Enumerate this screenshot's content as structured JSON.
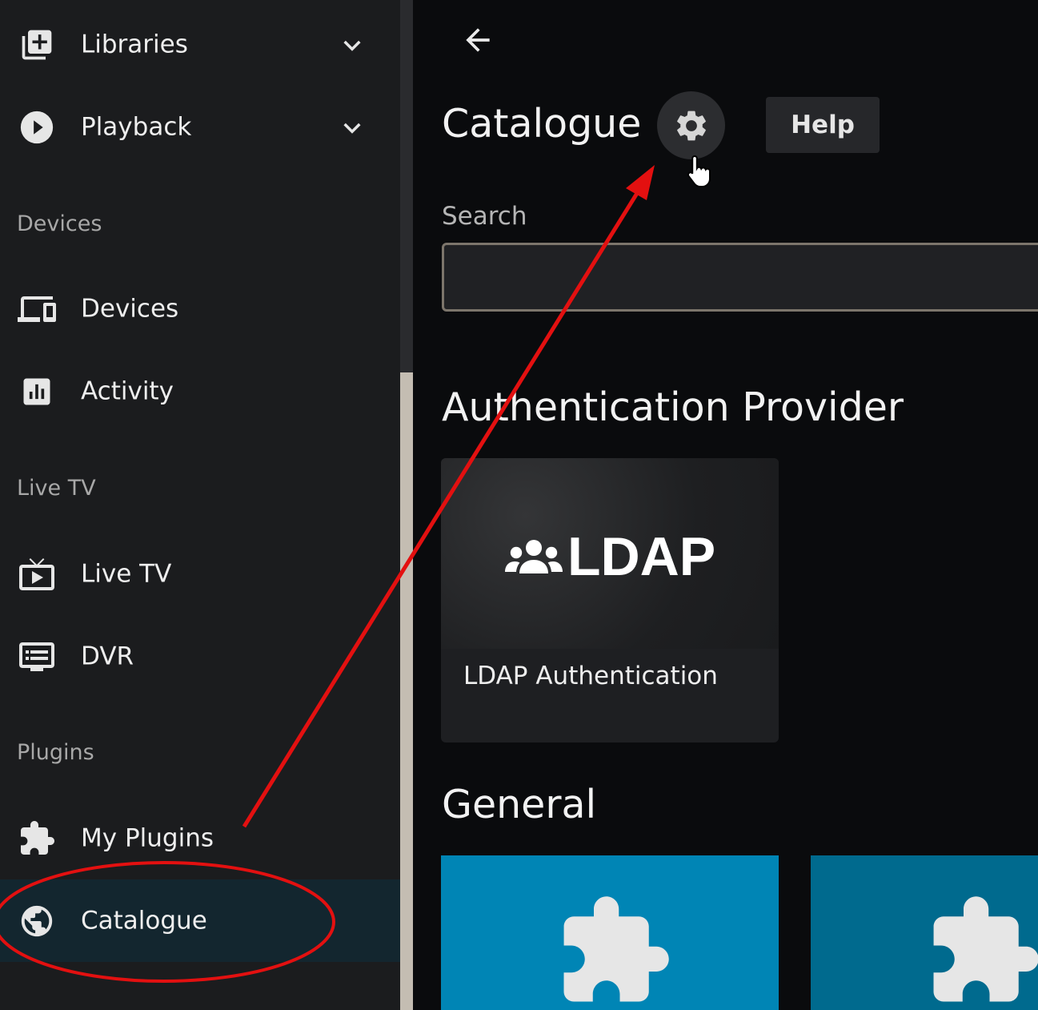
{
  "sidebar": {
    "items": [
      {
        "label": "Libraries",
        "icon": "library-add-icon",
        "expandable": true
      },
      {
        "label": "Playback",
        "icon": "play-circle-icon",
        "expandable": true
      },
      {
        "label": "Devices",
        "icon": "devices-icon"
      },
      {
        "label": "Activity",
        "icon": "activity-chart-icon"
      },
      {
        "label": "Live TV",
        "icon": "live-tv-icon"
      },
      {
        "label": "DVR",
        "icon": "dvr-icon"
      },
      {
        "label": "My Plugins",
        "icon": "puzzle-icon"
      },
      {
        "label": "Catalogue",
        "icon": "globe-icon",
        "active": true
      }
    ],
    "sections": {
      "devices": "Devices",
      "live_tv": "Live TV",
      "plugins": "Plugins"
    }
  },
  "header": {
    "title": "Catalogue",
    "help_label": "Help",
    "settings_icon": "gear-icon",
    "back_icon": "arrow-left-icon"
  },
  "search": {
    "label": "Search",
    "value": ""
  },
  "catalog": {
    "sections": [
      {
        "title": "Authentication Provider",
        "cards": [
          {
            "name": "LDAP Authentication",
            "logo_text": "LDAP",
            "logo_icon": "users-icon"
          }
        ]
      },
      {
        "title": "General",
        "cards": [
          {
            "icon": "puzzle-icon",
            "color": "#0085b5"
          },
          {
            "icon": "puzzle-icon",
            "color": "#006a8e"
          }
        ]
      }
    ]
  },
  "colors": {
    "sidebar_bg": "#1b1c1e",
    "active_item_bg": "#13262f",
    "main_bg": "#0a0b0d",
    "annotation_red": "#e31010",
    "plugin_tile_1": "#0085b5",
    "plugin_tile_2": "#006a8e"
  }
}
